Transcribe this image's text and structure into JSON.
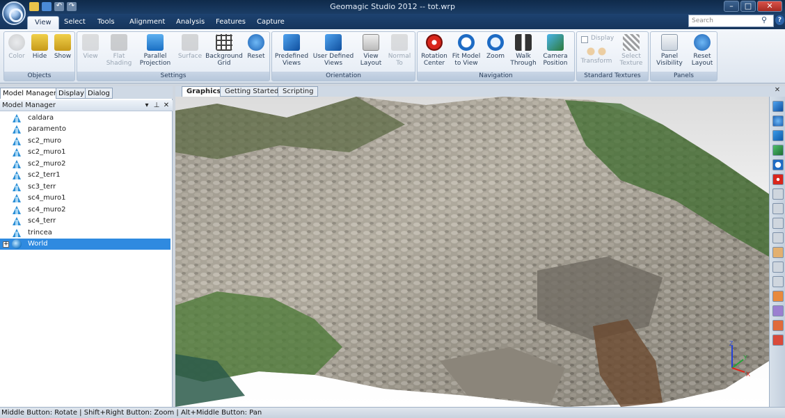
{
  "app": {
    "window_title": "Geomagic Studio 2012 -- tot.wrp"
  },
  "ribbon_tabs": [
    "View",
    "Select",
    "Tools",
    "Alignment",
    "Analysis",
    "Features",
    "Capture"
  ],
  "search": {
    "placeholder": "Search"
  },
  "groups": {
    "objects": {
      "label": "Objects",
      "buttons": [
        "Color",
        "Hide",
        "Show"
      ]
    },
    "settings": {
      "label": "Settings",
      "buttons": [
        "View",
        "Flat\nShading",
        "Parallel\nProjection",
        "Surface",
        "Background\nGrid",
        "Reset"
      ]
    },
    "orientation": {
      "label": "Orientation",
      "buttons": [
        "Predefined\nViews",
        "User Defined\nViews",
        "View\nLayout",
        "Normal\nTo"
      ]
    },
    "navigation": {
      "label": "Navigation",
      "buttons": [
        "Rotation\nCenter",
        "Fit Model\nto View",
        "Zoom",
        "Walk\nThrough",
        "Camera\nPosition"
      ]
    },
    "textures": {
      "label": "Standard Textures",
      "display": "Display",
      "buttons": [
        "Transform",
        "Select\nTexture"
      ]
    },
    "panels": {
      "label": "Panels",
      "buttons": [
        "Panel\nVisibility",
        "Reset\nLayout"
      ]
    }
  },
  "panel_tabs": [
    "Model Manager",
    "Display",
    "Dialog"
  ],
  "model_manager": {
    "header": "Model Manager",
    "items": [
      "caldara",
      "paramento",
      "sc2_muro",
      "sc2_muro1",
      "sc2_muro2",
      "sc2_terr1",
      "sc3_terr",
      "sc4_muro1",
      "sc4_muro2",
      "sc4_terr",
      "trincea"
    ],
    "world": "World"
  },
  "graphics_tabs": [
    "Graphics",
    "Getting Started",
    "Scripting"
  ],
  "axes": {
    "x": "X",
    "y": "Y",
    "z": "Z"
  },
  "status": "Middle Button: Rotate | Shift+Right Button: Zoom | Alt+Middle Button: Pan"
}
